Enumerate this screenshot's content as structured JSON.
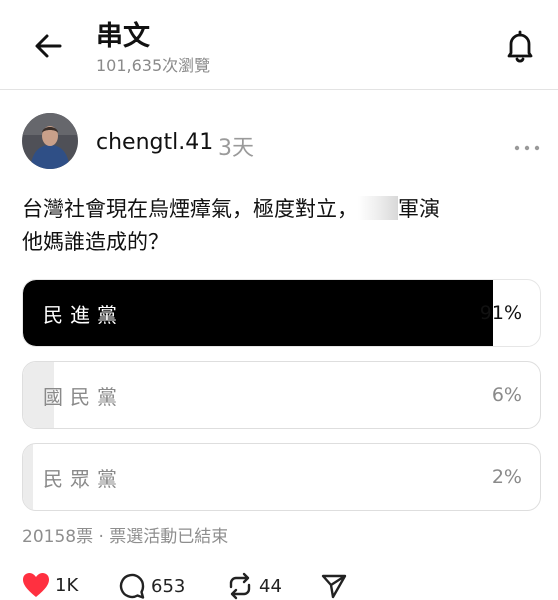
{
  "header": {
    "title": "串文",
    "views": "101,635次瀏覽"
  },
  "post": {
    "username": "chengtl.41",
    "time": "3天",
    "text_line1_a": "台灣社會現在烏煙瘴氣，極度對立，",
    "text_line1_b": "軍演",
    "text_line2": "他媽誰造成的？"
  },
  "poll": {
    "options": [
      {
        "label": "民進黨",
        "percent_text": "91%",
        "fraction": 0.91,
        "fill": "#000000",
        "label_color": "#ffffff",
        "pct_color": "#111111"
      },
      {
        "label": "國民黨",
        "percent_text": "6%",
        "fraction": 0.06,
        "fill": "#ececec",
        "label_color": "#8a8a8a",
        "pct_color": "#8a8a8a"
      },
      {
        "label": "民眾黨",
        "percent_text": "2%",
        "fraction": 0.02,
        "fill": "#ececec",
        "label_color": "#8a8a8a",
        "pct_color": "#8a8a8a"
      }
    ],
    "meta": "20158票 · 票選活動已結束"
  },
  "actions": {
    "likes": "1K",
    "comments": "653",
    "reposts": "44",
    "like_color": "#ff3040"
  }
}
